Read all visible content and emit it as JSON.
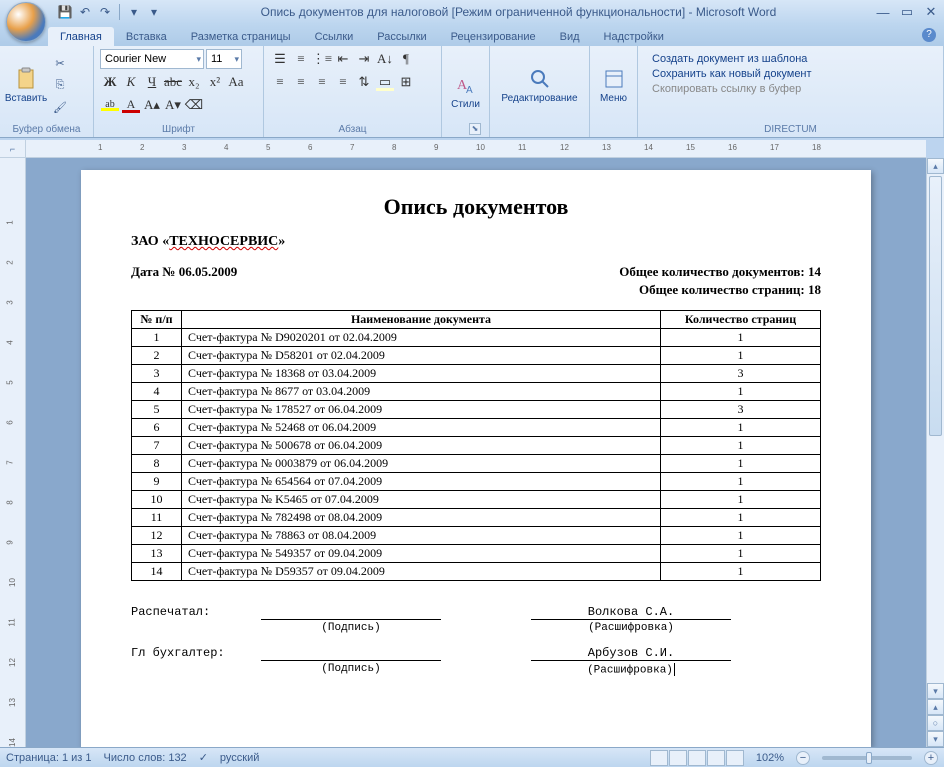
{
  "window": {
    "title": "Опись документов для налоговой [Режим ограниченной функциональности] - Microsoft Word"
  },
  "tabs": [
    "Главная",
    "Вставка",
    "Разметка страницы",
    "Ссылки",
    "Рассылки",
    "Рецензирование",
    "Вид",
    "Надстройки"
  ],
  "ribbon": {
    "clipboard": {
      "paste": "Вставить",
      "label": "Буфер обмена"
    },
    "font": {
      "name": "Courier New",
      "size": "11",
      "label": "Шрифт"
    },
    "paragraph": {
      "label": "Абзац"
    },
    "styles": {
      "btn": "Стили",
      "label": ""
    },
    "editing": {
      "btn": "Редактирование"
    },
    "menu": {
      "btn": "Меню"
    },
    "directum": {
      "items": [
        "Создать документ из шаблона",
        "Сохранить как новый документ",
        "Скопировать ссылку в буфер"
      ],
      "label": "DIRECTUM"
    }
  },
  "document": {
    "title": "Опись документов",
    "company_prefix": "ЗАО «",
    "company_name": "ТЕХНОСЕРВИС",
    "company_suffix": "»",
    "date_label": "Дата № 06.05.2009",
    "total_docs": "Общее количество документов: 14",
    "total_pages": "Общее количество страниц: 18",
    "headers": [
      "№ п/п",
      "Наименование документа",
      "Количество страниц"
    ],
    "rows": [
      {
        "n": "1",
        "name": "Счет-фактура № D9020201 от 02.04.2009",
        "p": "1"
      },
      {
        "n": "2",
        "name": "Счет-фактура № D58201 от 02.04.2009",
        "p": "1"
      },
      {
        "n": "3",
        "name": "Счет-фактура № 18368 от 03.04.2009",
        "p": "3"
      },
      {
        "n": "4",
        "name": "Счет-фактура № 8677 от 03.04.2009",
        "p": "1"
      },
      {
        "n": "5",
        "name": "Счет-фактура № 178527 от 06.04.2009",
        "p": "3"
      },
      {
        "n": "6",
        "name": "Счет-фактура № 52468 от 06.04.2009",
        "p": "1"
      },
      {
        "n": "7",
        "name": "Счет-фактура № 500678 от 06.04.2009",
        "p": "1"
      },
      {
        "n": "8",
        "name": "Счет-фактура № 0003879 от 06.04.2009",
        "p": "1"
      },
      {
        "n": "9",
        "name": "Счет-фактура № 654564 от 07.04.2009",
        "p": "1"
      },
      {
        "n": "10",
        "name": "Счет-фактура № K5465 от 07.04.2009",
        "p": "1"
      },
      {
        "n": "11",
        "name": "Счет-фактура № 782498 от 08.04.2009",
        "p": "1"
      },
      {
        "n": "12",
        "name": "Счет-фактура № 78863 от 08.04.2009",
        "p": "1"
      },
      {
        "n": "13",
        "name": "Счет-фактура № 549357 от 09.04.2009",
        "p": "1"
      },
      {
        "n": "14",
        "name": "Счет-фактура № D59357 от 09.04.2009",
        "p": "1"
      }
    ],
    "sign": {
      "printed_by": "Распечатал:",
      "signature": "(Подпись)",
      "person1": "Волкова С.А.",
      "decrypt": "(Расшифровка)",
      "accountant": "Гл бухгалтер:",
      "person2": "Арбузов С.И."
    }
  },
  "statusbar": {
    "page": "Страница: 1 из 1",
    "words": "Число слов: 132",
    "lang": "русский",
    "zoom": "102%"
  }
}
